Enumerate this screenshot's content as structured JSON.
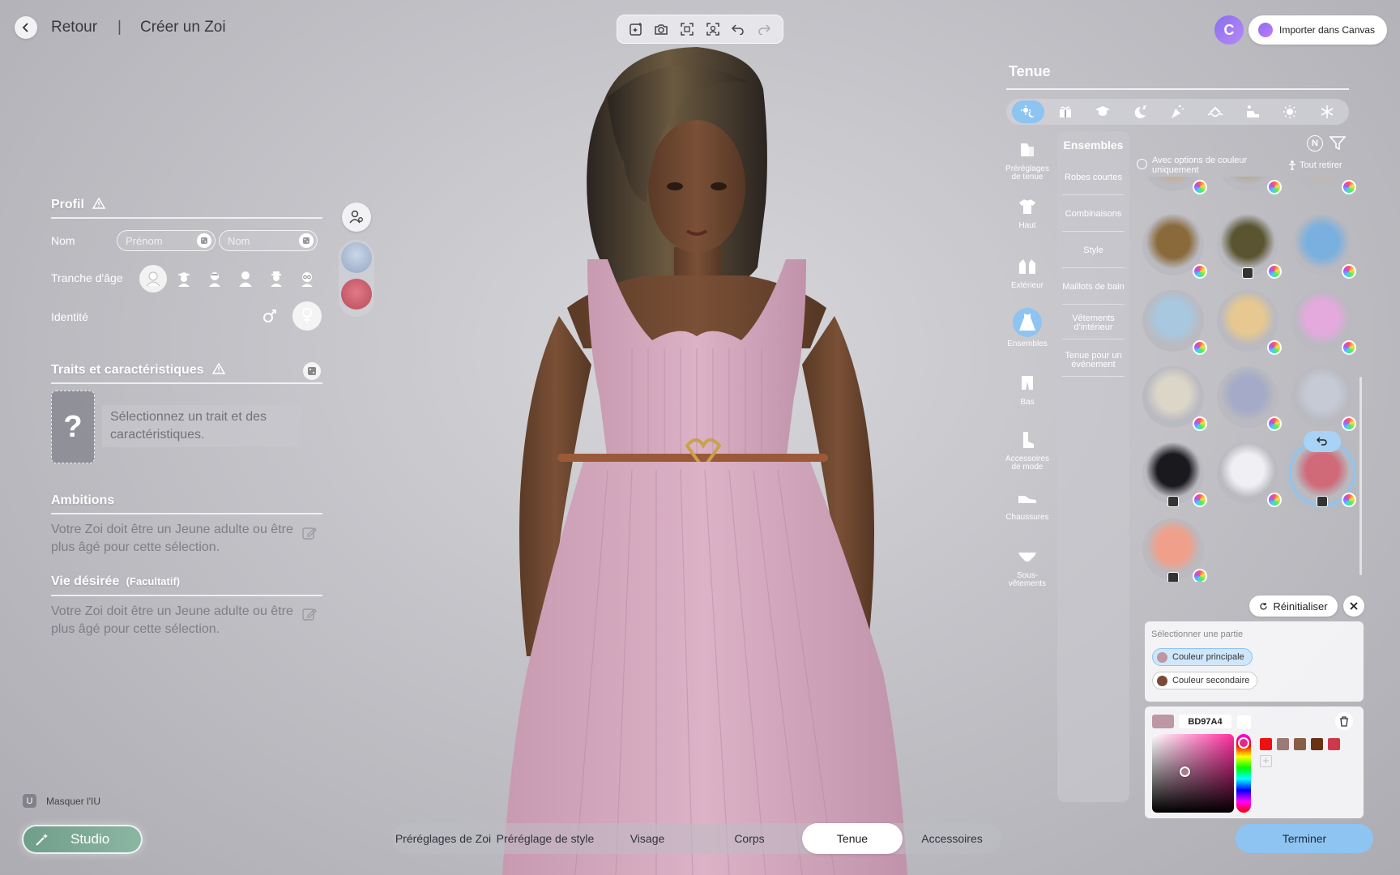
{
  "topbar": {
    "back_label": "Retour",
    "separator": "|",
    "title": "Créer un Zoi",
    "toolbar_icons": [
      "ai-sparkle-icon",
      "camera-icon",
      "focus-frame-icon",
      "face-frame-icon",
      "undo-icon",
      "redo-icon"
    ],
    "canvas_logo": "C",
    "import_label": "Importer dans Canvas"
  },
  "profile": {
    "title": "Profil",
    "name_label": "Nom",
    "first_name_placeholder": "Prénom",
    "last_name_placeholder": "Nom",
    "age_label": "Tranche d'âge",
    "age_options": [
      "toddler",
      "graduate",
      "young-adult",
      "adult",
      "elder-hat",
      "elder-glasses"
    ],
    "age_selected_index": 0,
    "identity_label": "Identité",
    "identity_selected": "female"
  },
  "traits": {
    "title": "Traits et caractéristiques",
    "slot_symbol": "?",
    "hint": "Sélectionnez un trait et des caractéristiques."
  },
  "ambitions": {
    "title": "Ambitions",
    "message": "Votre Zoi doit être un Jeune adulte ou être plus âgé pour cette sélection."
  },
  "desired_life": {
    "title": "Vie désirée",
    "optional": "(Facultatif)",
    "message": "Votre Zoi doit être un Jeune adulte ou être plus âgé pour cette sélection."
  },
  "footer_left": {
    "hide_key": "U",
    "hide_label": "Masquer l'IU",
    "studio_label": "Studio"
  },
  "bottom_tabs": [
    {
      "label": "Préréglages de Zoi",
      "active": false
    },
    {
      "label": "Préréglage de style",
      "active": false
    },
    {
      "label": "Visage",
      "active": false
    },
    {
      "label": "Corps",
      "active": false
    },
    {
      "label": "Tenue",
      "active": true
    },
    {
      "label": "Accessoires",
      "active": false
    }
  ],
  "outfit": {
    "title": "Tenue",
    "occasion_icons": [
      "everyday-icon",
      "gift-icon",
      "graduation-cap-icon",
      "moon-sleep-icon",
      "party-icon",
      "swim-icon",
      "sport-icon",
      "sun-icon",
      "snowflake-icon"
    ],
    "occasion_active_index": 0,
    "side_categories": [
      {
        "label": "Préréglages de tenue",
        "icon": "outfit-preset-icon"
      },
      {
        "label": "Haut",
        "icon": "shirt-icon"
      },
      {
        "label": "Extérieur",
        "icon": "jacket-icon"
      },
      {
        "label": "Ensembles",
        "icon": "dress-icon",
        "active": true
      },
      {
        "label": "Bas",
        "icon": "pants-icon"
      },
      {
        "label": "Accessoires de mode",
        "icon": "boot-icon"
      },
      {
        "label": "Chaussures",
        "icon": "shoe-icon"
      },
      {
        "label": "Sous-vêtements",
        "icon": "underwear-icon"
      }
    ],
    "sub_header": "Ensembles",
    "sub_items": [
      "Robes courtes",
      "Combinaisons",
      "Style",
      "Maillots de bain",
      "Vêtements d'intérieur",
      "Tenue pour un événement"
    ],
    "n_badge": "N",
    "color_option_label": "Avec options de couleur uniquement",
    "remove_all_label": "Tout retirer",
    "items": [
      {
        "fill": "#c9a98a",
        "cw": true
      },
      {
        "fill": "#b8a48a",
        "cw": true
      },
      {
        "fill": "#c8b4a4",
        "cw": true
      },
      {
        "fill": "#8a6a3a",
        "cw": true
      },
      {
        "fill": "#5a5530",
        "cw": true,
        "badge": true
      },
      {
        "fill": "#7ab0e0",
        "cw": true
      },
      {
        "fill": "#a8c8e0",
        "cw": true
      },
      {
        "fill": "#e6c890",
        "cw": true
      },
      {
        "fill": "#e4aadd",
        "cw": true
      },
      {
        "fill": "#dcd6c8",
        "cw": true
      },
      {
        "fill": "#a4aac8",
        "cw": true
      },
      {
        "fill": "#c6cad4",
        "cw": true
      },
      {
        "fill": "#1a1a1e",
        "cw": true,
        "badge": true
      },
      {
        "fill": "#f0f0f4",
        "cw": true
      },
      {
        "fill": "#d06a78",
        "cw": true,
        "badge": true,
        "selected": true
      },
      {
        "fill": "#f0a08a",
        "cw": true,
        "badge": true
      }
    ]
  },
  "color_editor": {
    "reset_label": "Réinitialiser",
    "select_part_label": "Sélectionner une partie",
    "parts": [
      {
        "label": "Couleur principale",
        "color": "#BD97A4",
        "active": true
      },
      {
        "label": "Couleur secondaire",
        "color": "#7a4a34",
        "active": false
      }
    ],
    "current_color": "#BD97A4",
    "hex": "BD97A4",
    "recent_swatches": [
      "#ee1111",
      "#9c7b74",
      "#8a5d45",
      "#6a3214",
      "#cc3a4a"
    ]
  },
  "finish_label": "Terminer"
}
